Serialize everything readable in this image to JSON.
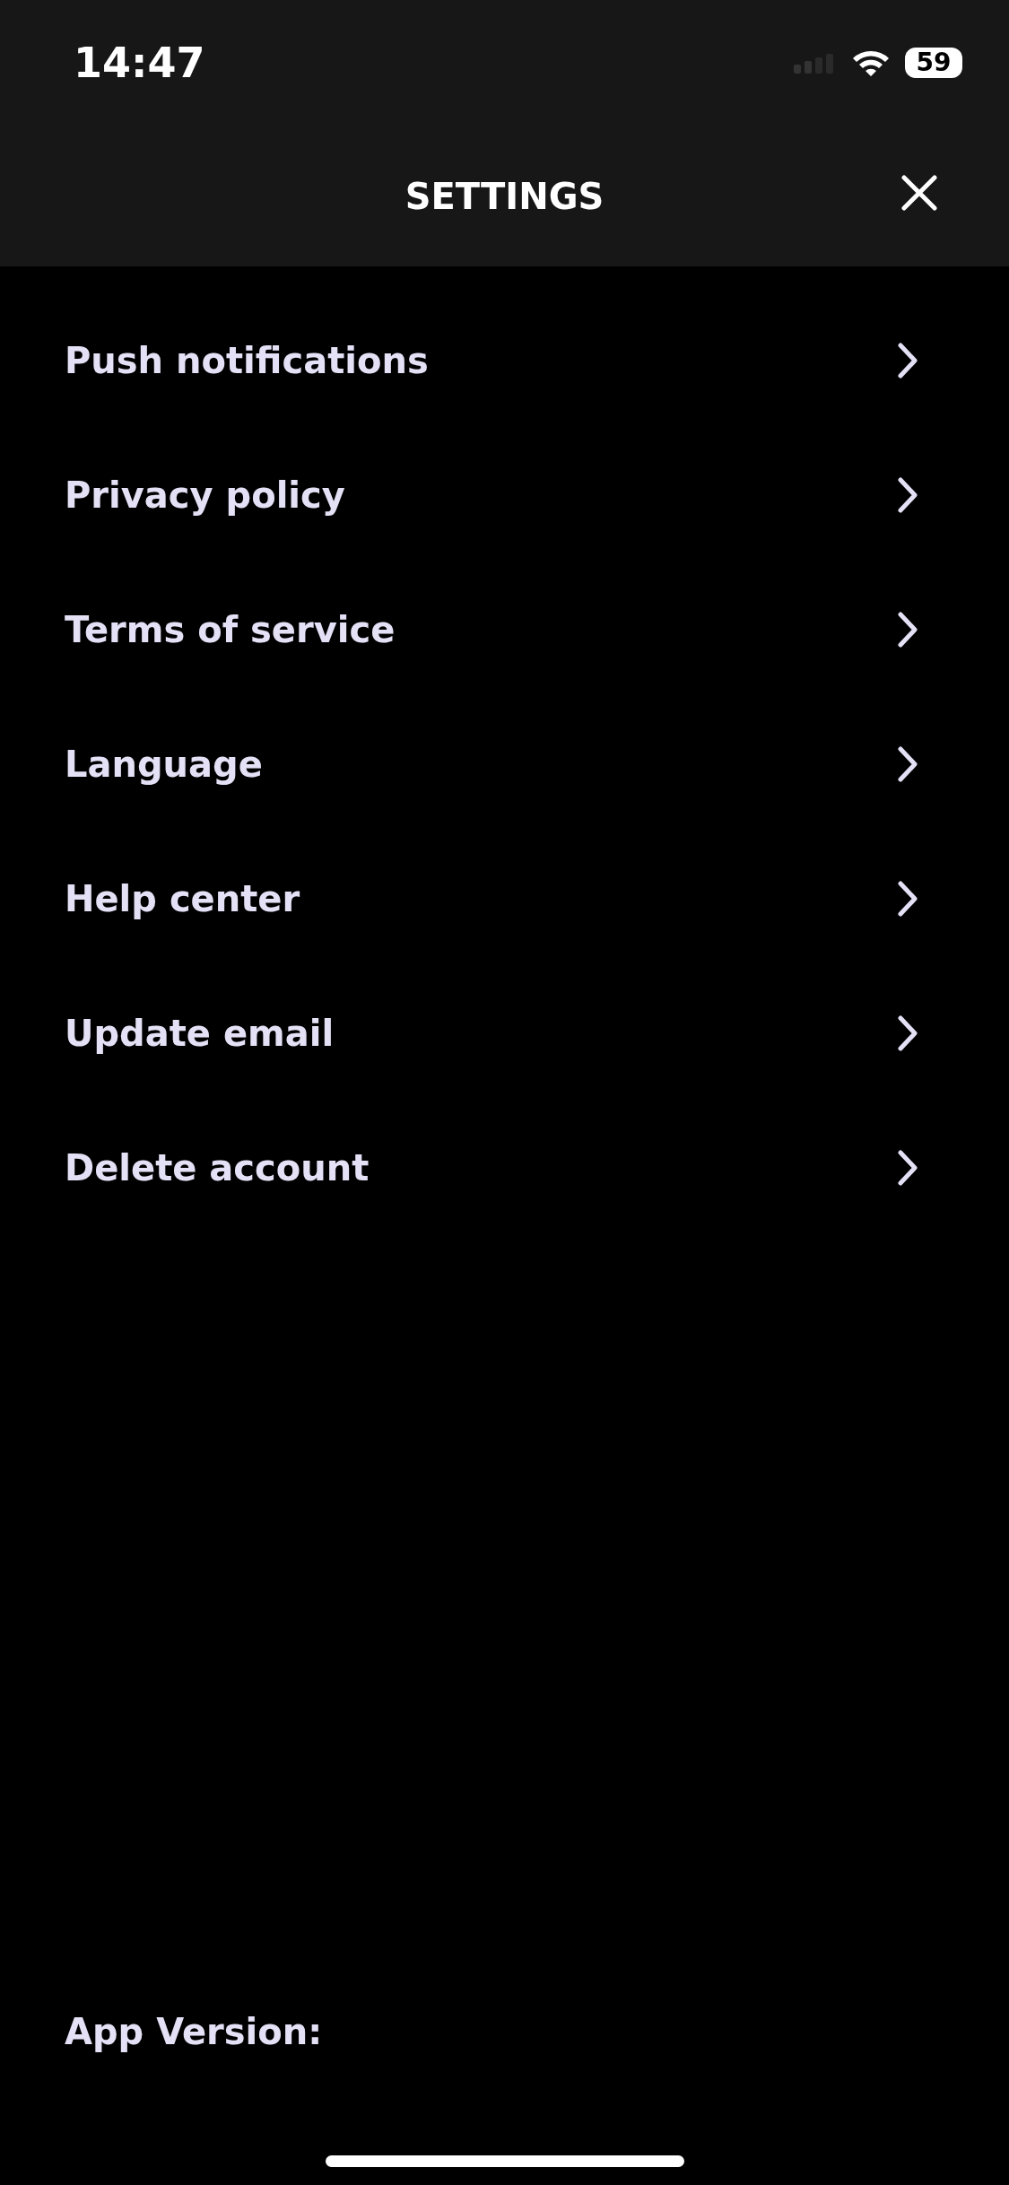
{
  "status_bar": {
    "time": "14:47",
    "battery": "59"
  },
  "header": {
    "title": "SETTINGS"
  },
  "items": [
    {
      "label": "Push notifications"
    },
    {
      "label": "Privacy policy"
    },
    {
      "label": "Terms of service"
    },
    {
      "label": "Language"
    },
    {
      "label": "Help center"
    },
    {
      "label": "Update email"
    },
    {
      "label": "Delete account"
    }
  ],
  "footer": {
    "app_version": "App Version:"
  }
}
